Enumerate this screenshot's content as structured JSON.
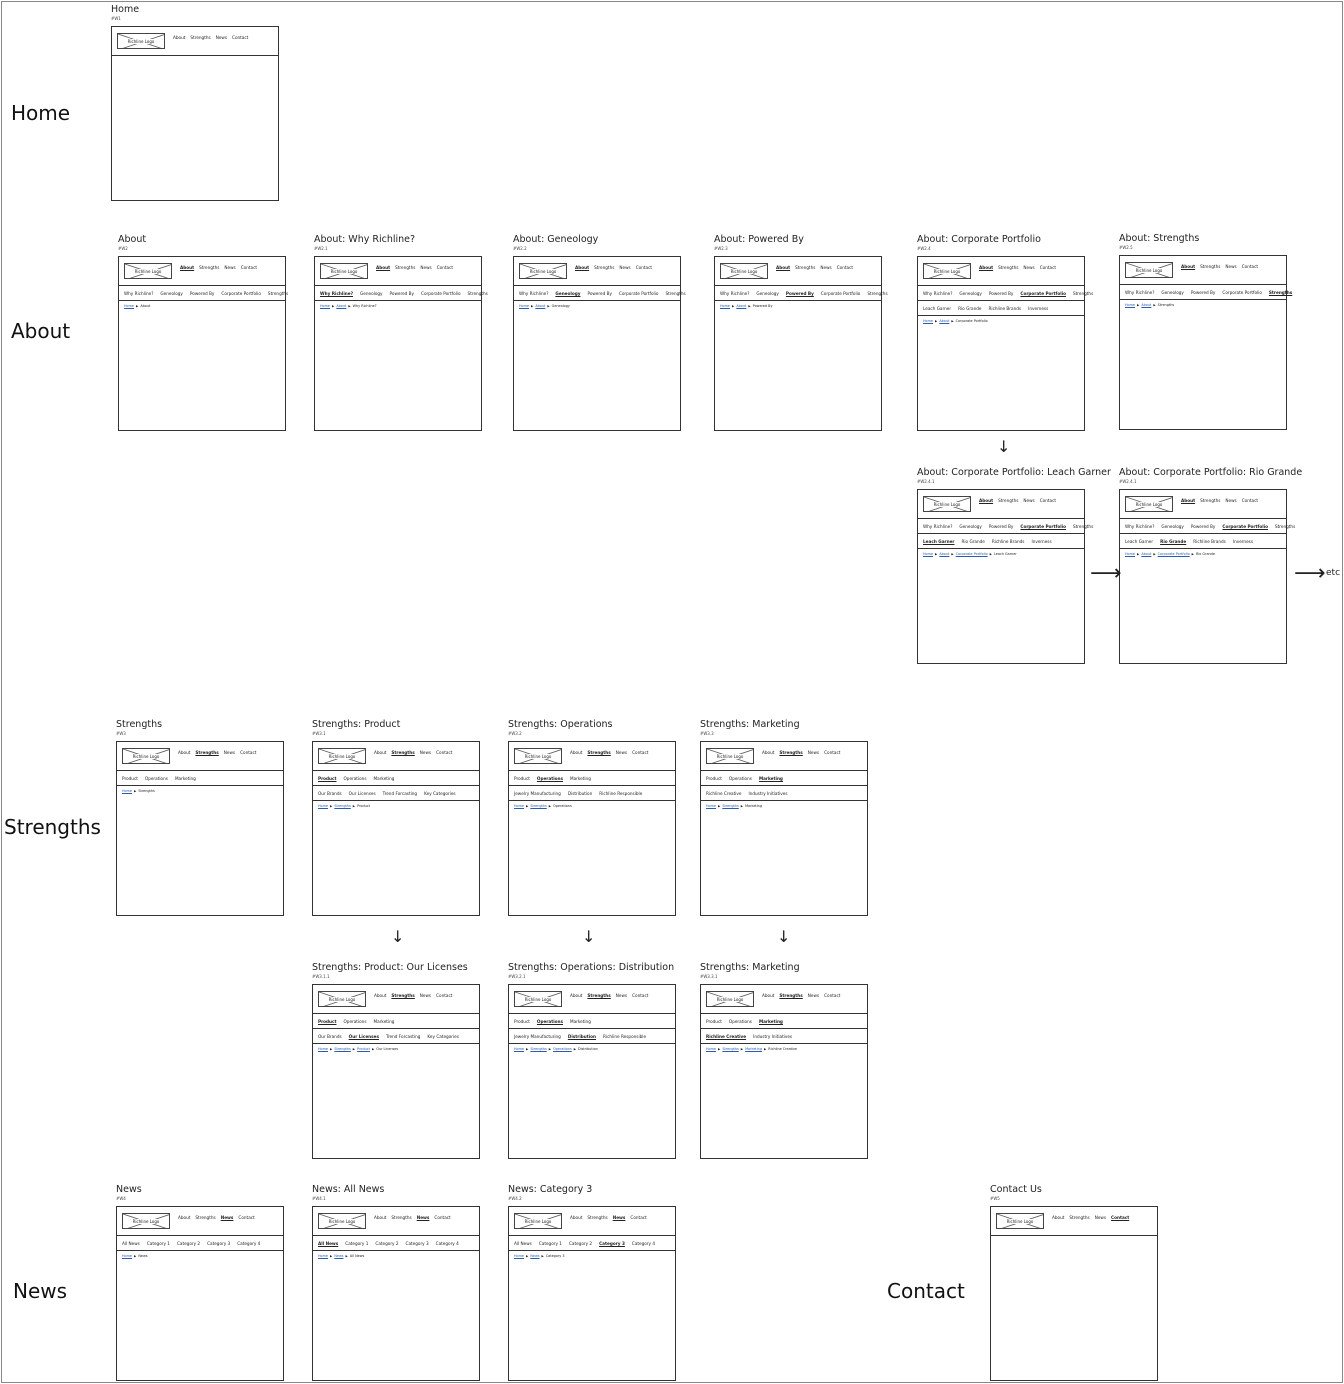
{
  "sections": [
    "Home",
    "About",
    "Strengths",
    "News",
    "Contact"
  ],
  "logo_label": "Richline Logo",
  "nav": [
    "About",
    "Strengths",
    "News",
    "Contact"
  ],
  "etc_label": "etc",
  "colors": {
    "link": "#2a5db0",
    "border": "#333333"
  },
  "pages": [
    {
      "id": "w1",
      "title": "Home",
      "code": "#W1",
      "nav_active": -1,
      "rows": [],
      "breadcrumb": []
    },
    {
      "id": "w2",
      "title": "About",
      "code": "#W2",
      "nav_active": 0,
      "rows": [
        {
          "items": [
            "Why Richline?",
            "Geneology",
            "Powered By",
            "Corporate Portfolio",
            "Strengths"
          ],
          "active": -1
        }
      ],
      "breadcrumb": [
        "Home",
        "About"
      ]
    },
    {
      "id": "w2.1",
      "title": "About:  Why Richline?",
      "code": "#W2.1",
      "nav_active": 0,
      "rows": [
        {
          "items": [
            "Why Richline?",
            "Geneology",
            "Powered By",
            "Corporate Portfolio",
            "Strengths"
          ],
          "active": 0
        }
      ],
      "breadcrumb": [
        "Home",
        "About",
        "Why Richline?"
      ]
    },
    {
      "id": "w2.2",
      "title": "About:  Geneology",
      "code": "#W2.2",
      "nav_active": 0,
      "rows": [
        {
          "items": [
            "Why Richline?",
            "Geneology",
            "Powered By",
            "Corporate Portfolio",
            "Strengths"
          ],
          "active": 1
        }
      ],
      "breadcrumb": [
        "Home",
        "About",
        "Geneology"
      ]
    },
    {
      "id": "w2.3",
      "title": "About:  Powered By",
      "code": "#W2.3",
      "nav_active": 0,
      "rows": [
        {
          "items": [
            "Why Richline?",
            "Geneology",
            "Powered By",
            "Corporate Portfolio",
            "Strengths"
          ],
          "active": 2
        }
      ],
      "breadcrumb": [
        "Home",
        "About",
        "Powered By"
      ]
    },
    {
      "id": "w2.4",
      "title": "About:  Corporate Portfolio",
      "code": "#W2.4",
      "nav_active": 0,
      "rows": [
        {
          "items": [
            "Why Richline?",
            "Geneology",
            "Powered By",
            "Corporate Portfolio",
            "Strengths"
          ],
          "active": 3
        },
        {
          "items": [
            "Leach Garner",
            "Rio Grande",
            "Richline Brands",
            "Inverness"
          ],
          "active": -1
        }
      ],
      "breadcrumb": [
        "Home",
        "About",
        "Corporate Portfolio"
      ]
    },
    {
      "id": "w2.5",
      "title": "About:  Strengths",
      "code": "#W2.5",
      "nav_active": 0,
      "rows": [
        {
          "items": [
            "Why Richline?",
            "Geneology",
            "Powered By",
            "Corporate Portfolio",
            "Strengths"
          ],
          "active": 4
        }
      ],
      "breadcrumb": [
        "Home",
        "About",
        "Strengths"
      ]
    },
    {
      "id": "w2.4.1a",
      "title": "About:  Corporate Portfolio:  Leach Garner",
      "code": "#W2.4.1",
      "nav_active": 0,
      "rows": [
        {
          "items": [
            "Why Richline?",
            "Geneology",
            "Powered By",
            "Corporate Portfolio",
            "Strengths"
          ],
          "active": 3
        },
        {
          "items": [
            "Leach Garner",
            "Rio Grande",
            "Richline Brands",
            "Inverness"
          ],
          "active": 0
        }
      ],
      "breadcrumb": [
        "Home",
        "About",
        "Corporate Portfolio",
        "Leach Garner"
      ]
    },
    {
      "id": "w2.4.1b",
      "title": "About:  Corporate Portfolio:  Rio Grande",
      "code": "#W2.4.1",
      "nav_active": 0,
      "rows": [
        {
          "items": [
            "Why Richline?",
            "Geneology",
            "Powered By",
            "Corporate Portfolio",
            "Strengths"
          ],
          "active": 3
        },
        {
          "items": [
            "Leach Garner",
            "Rio Grande",
            "Richline Brands",
            "Inverness"
          ],
          "active": 1
        }
      ],
      "breadcrumb": [
        "Home",
        "About",
        "Corporate Portfolio",
        "Rio Grande"
      ]
    },
    {
      "id": "w3",
      "title": "Strengths",
      "code": "#W3",
      "nav_active": 1,
      "rows": [
        {
          "items": [
            "Product",
            "Operations",
            "Marketing"
          ],
          "active": -1
        }
      ],
      "breadcrumb": [
        "Home",
        "Strengths"
      ]
    },
    {
      "id": "w3.1",
      "title": "Strengths: Product",
      "code": "#W3.1",
      "nav_active": 1,
      "rows": [
        {
          "items": [
            "Product",
            "Operations",
            "Marketing"
          ],
          "active": 0
        },
        {
          "items": [
            "Our Brands",
            "Our Licenses",
            "Trend Forcasting",
            "Key Categories"
          ],
          "active": -1
        }
      ],
      "breadcrumb": [
        "Home",
        "Strengths",
        "Product"
      ]
    },
    {
      "id": "w3.2",
      "title": "Strengths: Operations",
      "code": "#W3.2",
      "nav_active": 1,
      "rows": [
        {
          "items": [
            "Product",
            "Operations",
            "Marketing"
          ],
          "active": 1
        },
        {
          "items": [
            "Jewelry Manufacturing",
            "Distribution",
            "Richline Responsible"
          ],
          "active": -1
        }
      ],
      "breadcrumb": [
        "Home",
        "Strengths",
        "Operations"
      ]
    },
    {
      "id": "w3.3",
      "title": "Strengths: Marketing",
      "code": "#W3.3",
      "nav_active": 1,
      "rows": [
        {
          "items": [
            "Product",
            "Operations",
            "Marketing"
          ],
          "active": 2
        },
        {
          "items": [
            "Richline Creative",
            "Industry Initiatives"
          ],
          "active": -1
        }
      ],
      "breadcrumb": [
        "Home",
        "Strengths",
        "Marketing"
      ]
    },
    {
      "id": "w3.1.1",
      "title": "Strengths: Product: Our Licenses",
      "code": "#W3.1.1",
      "nav_active": 1,
      "rows": [
        {
          "items": [
            "Product",
            "Operations",
            "Marketing"
          ],
          "active": 0
        },
        {
          "items": [
            "Our Brands",
            "Our Licenses",
            "Trend Forcasting",
            "Key Categories"
          ],
          "active": 1
        }
      ],
      "breadcrumb": [
        "Home",
        "Strengths",
        "Product",
        "Our Licenses"
      ]
    },
    {
      "id": "w3.2.1",
      "title": "Strengths: Operations: Distribution",
      "code": "#W3.2.1",
      "nav_active": 1,
      "rows": [
        {
          "items": [
            "Product",
            "Operations",
            "Marketing"
          ],
          "active": 1
        },
        {
          "items": [
            "Jewelry Manufacturing",
            "Distribution",
            "Richline Responsible"
          ],
          "active": 1
        }
      ],
      "breadcrumb": [
        "Home",
        "Strengths",
        "Operations",
        "Distribution"
      ]
    },
    {
      "id": "w3.3.1",
      "title": "Strengths: Marketing",
      "code": "#W3.3.1",
      "nav_active": 1,
      "rows": [
        {
          "items": [
            "Product",
            "Operations",
            "Marketing"
          ],
          "active": 2
        },
        {
          "items": [
            "Richline Creative",
            "Industry Initiatives"
          ],
          "active": 0
        }
      ],
      "breadcrumb": [
        "Home",
        "Strengths",
        "Marketing",
        "Richline Creative"
      ]
    },
    {
      "id": "w4",
      "title": "News",
      "code": "#W4",
      "nav_active": 2,
      "rows": [
        {
          "items": [
            "All News",
            "Category 1",
            "Category 2",
            "Category 3",
            "Category 4"
          ],
          "active": -1
        }
      ],
      "breadcrumb": [
        "Home",
        "News"
      ]
    },
    {
      "id": "w4.1",
      "title": "News: All News",
      "code": "#W4.1",
      "nav_active": 2,
      "rows": [
        {
          "items": [
            "All News",
            "Category 1",
            "Category 2",
            "Category 3",
            "Category 4"
          ],
          "active": 0
        }
      ],
      "breadcrumb": [
        "Home",
        "News",
        "All News"
      ]
    },
    {
      "id": "w4.2",
      "title": "News: Category 3",
      "code": "#W4.2",
      "nav_active": 2,
      "rows": [
        {
          "items": [
            "All News",
            "Category 1",
            "Category 2",
            "Category 3",
            "Category 4"
          ],
          "active": 3
        }
      ],
      "breadcrumb": [
        "Home",
        "News",
        "Category 3"
      ]
    },
    {
      "id": "w5",
      "title": "Contact Us",
      "code": "#W5",
      "nav_active": 3,
      "rows": [],
      "breadcrumb": []
    }
  ]
}
